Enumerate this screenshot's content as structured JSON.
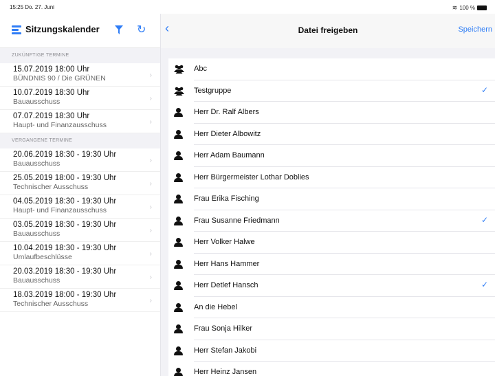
{
  "statusbar": {
    "time": "15:25  Do. 27. Juni",
    "battery": "100 %"
  },
  "left": {
    "title": "Sitzungskalender",
    "sections": [
      {
        "header": "ZUKÜNFTIGE TERMINE",
        "items": [
          {
            "date": "15.07.2019 18:00 Uhr",
            "group": "BÜNDNIS 90 / Die GRÜNEN"
          },
          {
            "date": "10.07.2019 18:30 Uhr",
            "group": "Bauausschuss"
          },
          {
            "date": "07.07.2019 18:30 Uhr",
            "group": "Haupt- und Finanzausschuss"
          }
        ]
      },
      {
        "header": "VERGANGENE TERMINE",
        "items": [
          {
            "date": "20.06.2019 18:30 - 19:30 Uhr",
            "group": "Bauausschuss"
          },
          {
            "date": "25.05.2019 18:00 - 19:30 Uhr",
            "group": "Technischer Ausschuss"
          },
          {
            "date": "04.05.2019 18:30 - 19:30 Uhr",
            "group": "Haupt- und Finanzausschuss"
          },
          {
            "date": "03.05.2019 18:30 - 19:30 Uhr",
            "group": "Bauausschuss"
          },
          {
            "date": "10.04.2019 18:30 - 19:30 Uhr",
            "group": "Umlaufbeschlüsse"
          },
          {
            "date": "20.03.2019 18:30 - 19:30 Uhr",
            "group": "Bauausschuss"
          },
          {
            "date": "18.03.2019 18:00 - 19:30 Uhr",
            "group": "Technischer Ausschuss"
          }
        ]
      }
    ]
  },
  "right": {
    "title": "Datei freigeben",
    "save_label": "Speichern",
    "recipients": [
      {
        "name": "Abc",
        "type": "group",
        "checked": false
      },
      {
        "name": "Testgruppe",
        "type": "group",
        "checked": true
      },
      {
        "name": "Herr Dr. Ralf Albers",
        "type": "person",
        "checked": false
      },
      {
        "name": "Herr Dieter Albowitz",
        "type": "person",
        "checked": false
      },
      {
        "name": "Herr Adam Baumann",
        "type": "person",
        "checked": false
      },
      {
        "name": "Herr Bürgermeister Lothar Doblies",
        "type": "person",
        "checked": false
      },
      {
        "name": "Frau Erika Fisching",
        "type": "person",
        "checked": false
      },
      {
        "name": "Frau Susanne Friedmann",
        "type": "person",
        "checked": true
      },
      {
        "name": "Herr Volker Halwe",
        "type": "person",
        "checked": false
      },
      {
        "name": "Herr Hans Hammer",
        "type": "person",
        "checked": false
      },
      {
        "name": "Herr Detlef Hansch",
        "type": "person",
        "checked": true
      },
      {
        "name": "An die Hebel",
        "type": "person",
        "checked": false
      },
      {
        "name": "Frau Sonja Hilker",
        "type": "person",
        "checked": false
      },
      {
        "name": "Herr Stefan Jakobi",
        "type": "person",
        "checked": false
      },
      {
        "name": "Herr Heinz Jansen",
        "type": "person",
        "checked": false
      }
    ]
  },
  "icons": {
    "menu": "menu-icon",
    "filter": "filter-icon",
    "refresh": "refresh-icon",
    "back": "chevron-left-icon",
    "person": "person-icon",
    "group": "group-icon",
    "check": "checkmark-icon",
    "chevron": "chevron-right-icon"
  },
  "colors": {
    "accent": "#2f7df6"
  }
}
